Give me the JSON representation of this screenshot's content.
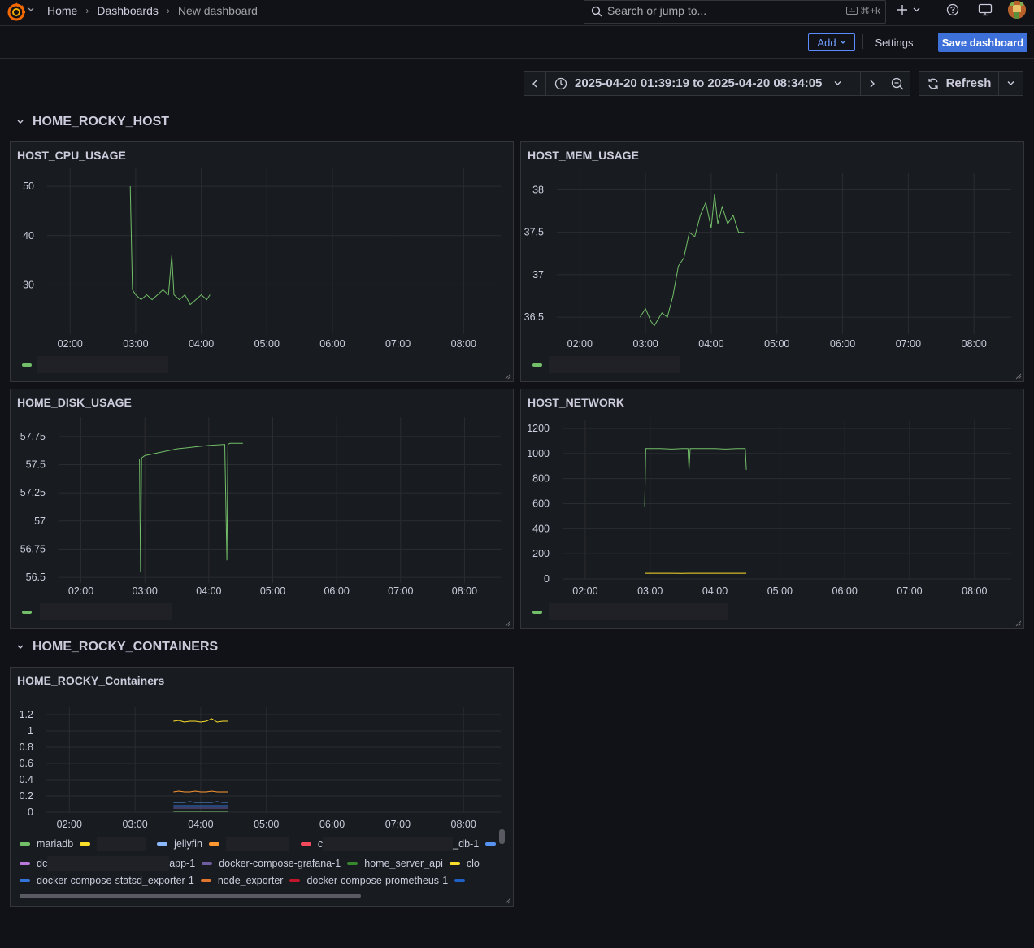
{
  "breadcrumb": {
    "home": "Home",
    "dashboards": "Dashboards",
    "current": "New dashboard"
  },
  "search": {
    "placeholder": "Search or jump to...",
    "shortcut": "⌘+k"
  },
  "toolbar": {
    "add_label": "Add",
    "settings_label": "Settings",
    "save_label": "Save dashboard"
  },
  "time_range": {
    "label": "2025-04-20 01:39:19 to 2025-04-20 08:34:05",
    "refresh_label": "Refresh"
  },
  "rows": [
    {
      "title": "HOME_ROCKY_HOST"
    },
    {
      "title": "HOME_ROCKY_CONTAINERS"
    }
  ],
  "x_ticks": [
    "02:00",
    "03:00",
    "04:00",
    "05:00",
    "06:00",
    "07:00",
    "08:00"
  ],
  "panels": {
    "cpu": {
      "title": "HOST_CPU_USAGE",
      "y_ticks": [
        "50",
        "40",
        "30"
      ]
    },
    "mem": {
      "title": "HOST_MEM_USAGE",
      "y_ticks": [
        "38",
        "37.5",
        "37",
        "36.5"
      ]
    },
    "disk": {
      "title": "HOME_DISK_USAGE",
      "y_ticks": [
        "57.75",
        "57.5",
        "57.25",
        "57",
        "56.75",
        "56.5"
      ]
    },
    "net": {
      "title": "HOST_NETWORK",
      "y_ticks": [
        "1200",
        "1000",
        "800",
        "600",
        "400",
        "200",
        "0"
      ]
    },
    "containers": {
      "title": "HOME_ROCKY_Containers",
      "y_ticks": [
        "1.2",
        "1",
        "0.8",
        "0.6",
        "0.4",
        "0.2",
        "0"
      ],
      "legend": {
        "row1": [
          {
            "label": "mariadb",
            "color": "#73bf69"
          },
          {
            "label": "",
            "color": "#fade2a"
          },
          {
            "label": "jellyfin",
            "color": "#8ab8ff"
          },
          {
            "label": "",
            "color": "#ff9830"
          },
          {
            "label": "_db-1",
            "color": "#f2495c",
            "prefix": "c"
          },
          {
            "label": "",
            "color": "#5794f2"
          }
        ],
        "row2": [
          {
            "label": "app-1",
            "color": "#b877d9",
            "prefix": "dc"
          },
          {
            "label": "docker-compose-grafana-1",
            "color": "#705da0"
          },
          {
            "label": "home_server_api",
            "color": "#37872d"
          },
          {
            "label": "clo",
            "color": "#fade2a"
          }
        ],
        "row3": [
          {
            "label": "docker-compose-statsd_exporter-1",
            "color": "#3274d9"
          },
          {
            "label": "node_exporter",
            "color": "#e0752d"
          },
          {
            "label": "docker-compose-prometheus-1",
            "color": "#c4162a"
          },
          {
            "label": "",
            "color": "#1f60c4"
          }
        ]
      }
    }
  },
  "chart_data": [
    {
      "type": "line",
      "title": "HOST_CPU_USAGE",
      "ylim": [
        20,
        52
      ],
      "x": [
        "02:55",
        "02:57",
        "03:00",
        "03:05",
        "03:10",
        "03:15",
        "03:20",
        "03:25",
        "03:30",
        "03:33",
        "03:35",
        "03:40",
        "03:45",
        "03:50",
        "03:55",
        "04:00",
        "04:05",
        "04:08"
      ],
      "series": [
        {
          "values": [
            50,
            29,
            28,
            27,
            28,
            27,
            28,
            29,
            28,
            36,
            28,
            27,
            28,
            26,
            27,
            28,
            27,
            28
          ]
        }
      ]
    },
    {
      "type": "line",
      "title": "HOST_MEM_USAGE",
      "ylim": [
        36.3,
        38.1
      ],
      "x": [
        "02:55",
        "03:00",
        "03:05",
        "03:08",
        "03:15",
        "03:20",
        "03:25",
        "03:30",
        "03:35",
        "03:40",
        "03:45",
        "03:50",
        "03:55",
        "04:00",
        "04:03",
        "04:06",
        "04:10",
        "04:15",
        "04:20",
        "04:25",
        "04:30"
      ],
      "series": [
        {
          "values": [
            36.5,
            36.6,
            36.45,
            36.4,
            36.55,
            36.5,
            36.75,
            37.1,
            37.2,
            37.5,
            37.45,
            37.7,
            37.85,
            37.55,
            37.95,
            37.6,
            37.8,
            37.6,
            37.7,
            37.5,
            37.5
          ]
        }
      ]
    },
    {
      "type": "line",
      "title": "HOME_DISK_USAGE",
      "ylim": [
        56.45,
        57.85
      ],
      "x": [
        "02:55",
        "02:56",
        "02:57",
        "03:00",
        "03:10",
        "03:20",
        "03:30",
        "03:40",
        "03:50",
        "04:00",
        "04:15",
        "04:17",
        "04:18",
        "04:20",
        "04:30",
        "04:32"
      ],
      "series": [
        {
          "values": [
            57.55,
            56.55,
            57.56,
            57.58,
            57.6,
            57.62,
            57.64,
            57.65,
            57.66,
            57.67,
            57.68,
            56.65,
            57.68,
            57.69,
            57.69,
            57.69
          ]
        }
      ]
    },
    {
      "type": "line",
      "title": "HOST_NETWORK",
      "ylim": [
        0,
        1200
      ],
      "x": [
        "02:55",
        "02:56",
        "03:00",
        "03:10",
        "03:20",
        "03:30",
        "03:35",
        "03:36",
        "03:37",
        "03:40",
        "03:50",
        "04:00",
        "04:10",
        "04:20",
        "04:28",
        "04:29"
      ],
      "series": [
        {
          "values": [
            580,
            1040,
            1040,
            1040,
            1035,
            1040,
            1040,
            870,
            1040,
            1040,
            1040,
            1040,
            1035,
            1040,
            1040,
            870
          ]
        },
        {
          "values": [
            45,
            45,
            45,
            45,
            45,
            44,
            45,
            45,
            45,
            45,
            45,
            45,
            45,
            45,
            45,
            45
          ]
        }
      ]
    },
    {
      "type": "line",
      "title": "HOME_ROCKY_Containers",
      "ylim": [
        0,
        1.2
      ],
      "x": [
        "03:35",
        "03:40",
        "03:45",
        "03:50",
        "03:55",
        "04:00",
        "04:05",
        "04:10",
        "04:15",
        "04:20",
        "04:25"
      ],
      "series": [
        {
          "name": "clo",
          "values": [
            1.12,
            1.13,
            1.11,
            1.12,
            1.12,
            1.11,
            1.12,
            1.15,
            1.11,
            1.12,
            1.12
          ]
        },
        {
          "name": "node_exporter",
          "values": [
            0.25,
            0.26,
            0.25,
            0.25,
            0.26,
            0.25,
            0.25,
            0.26,
            0.25,
            0.25,
            0.25
          ]
        },
        {
          "name": "jellyfin",
          "values": [
            0.12,
            0.12,
            0.12,
            0.13,
            0.12,
            0.12,
            0.12,
            0.12,
            0.13,
            0.12,
            0.12
          ]
        },
        {
          "name": "docker-compose-statsd_exporter-1",
          "values": [
            0.08,
            0.08,
            0.08,
            0.08,
            0.08,
            0.08,
            0.08,
            0.08,
            0.08,
            0.08,
            0.08
          ]
        },
        {
          "name": "docker-compose-grafana-1",
          "values": [
            0.05,
            0.05,
            0.05,
            0.05,
            0.05,
            0.05,
            0.05,
            0.05,
            0.05,
            0.05,
            0.05
          ]
        },
        {
          "name": "mariadb",
          "values": [
            0.01,
            0.01,
            0.01,
            0.01,
            0.01,
            0.01,
            0.01,
            0.01,
            0.01,
            0.01,
            0.01
          ]
        }
      ]
    }
  ]
}
